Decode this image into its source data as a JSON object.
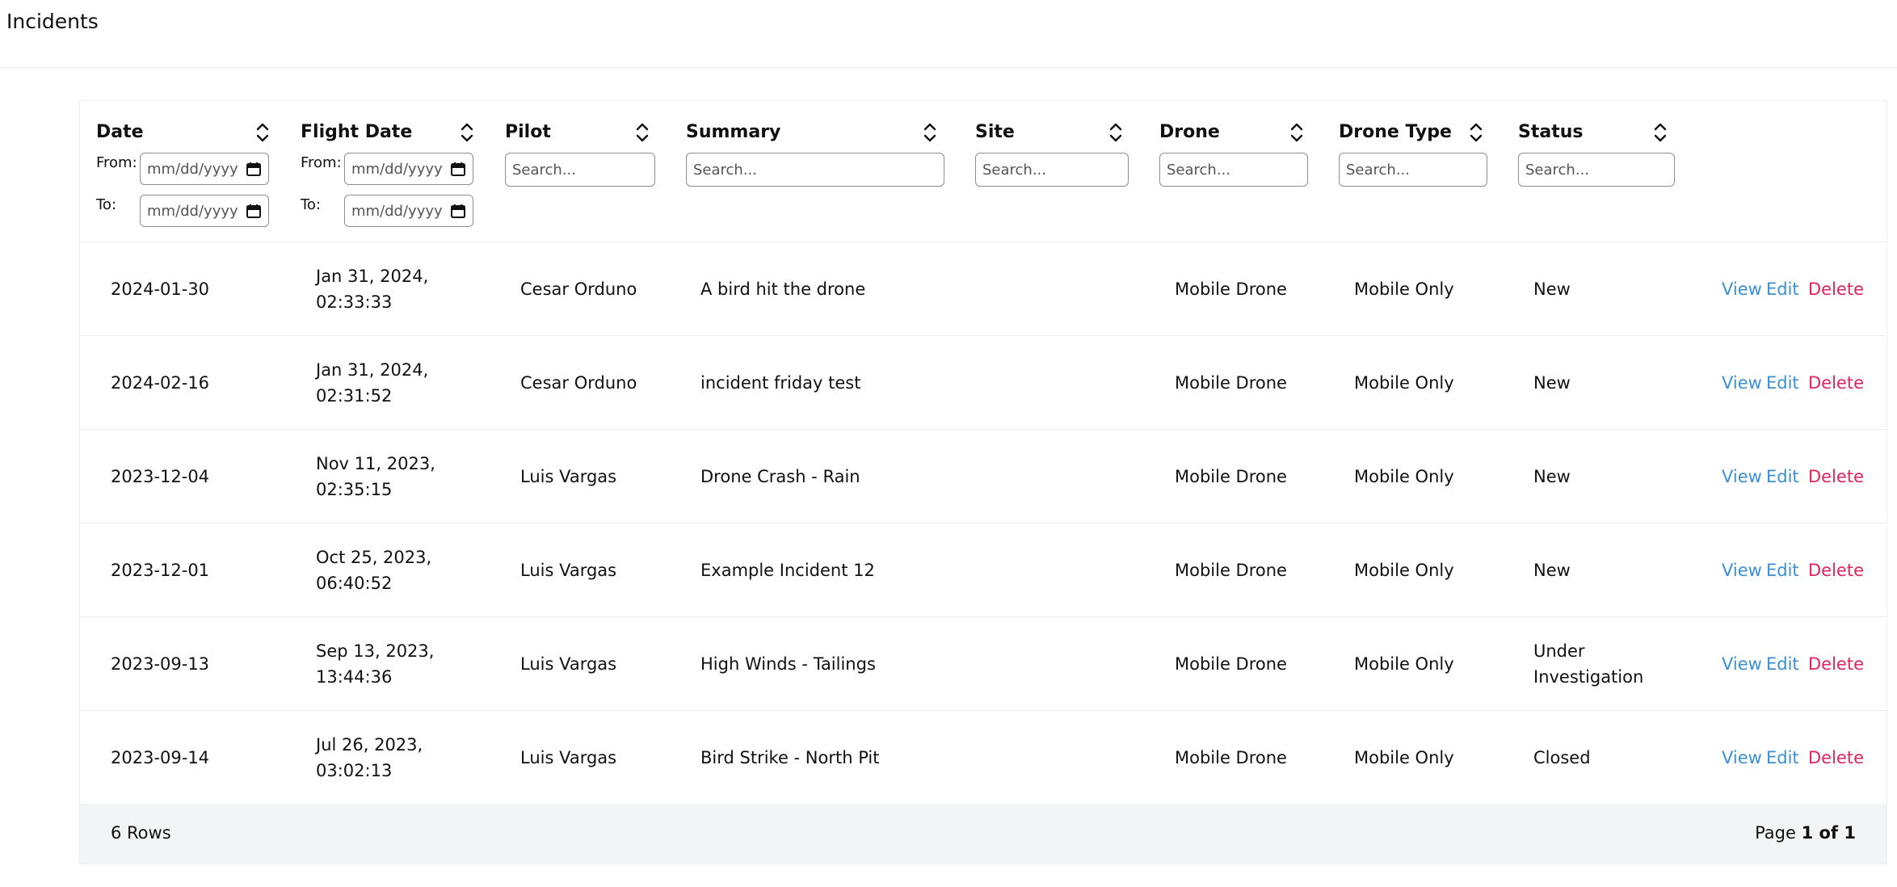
{
  "page": {
    "title": "Incidents"
  },
  "columns": [
    {
      "key": "date",
      "label": "Date",
      "filter": "date-range"
    },
    {
      "key": "flight_date",
      "label": "Flight Date",
      "filter": "date-range"
    },
    {
      "key": "pilot",
      "label": "Pilot",
      "filter": "search"
    },
    {
      "key": "summary",
      "label": "Summary",
      "filter": "search"
    },
    {
      "key": "site",
      "label": "Site",
      "filter": "search"
    },
    {
      "key": "drone",
      "label": "Drone",
      "filter": "search"
    },
    {
      "key": "drone_type",
      "label": "Drone Type",
      "filter": "search"
    },
    {
      "key": "status",
      "label": "Status",
      "filter": "search"
    }
  ],
  "filters": {
    "search_placeholder": "Search...",
    "date_placeholder": "mm/dd/yyyy",
    "from_label": "From:",
    "to_label": "To:"
  },
  "rows": [
    {
      "date": "2024-01-30",
      "flight_date": "Jan 31, 2024, 02:33:33",
      "pilot": "Cesar Orduno",
      "summary": "A bird hit the drone",
      "site": "",
      "drone": "Mobile Drone",
      "drone_type": "Mobile Only",
      "status": "New"
    },
    {
      "date": "2024-02-16",
      "flight_date": "Jan 31, 2024, 02:31:52",
      "pilot": "Cesar Orduno",
      "summary": "incident friday test",
      "site": "",
      "drone": "Mobile Drone",
      "drone_type": "Mobile Only",
      "status": "New"
    },
    {
      "date": "2023-12-04",
      "flight_date": "Nov 11, 2023, 02:35:15",
      "pilot": "Luis Vargas",
      "summary": "Drone Crash - Rain",
      "site": "",
      "drone": "Mobile Drone",
      "drone_type": "Mobile Only",
      "status": "New"
    },
    {
      "date": "2023-12-01",
      "flight_date": "Oct 25, 2023, 06:40:52",
      "pilot": "Luis Vargas",
      "summary": "Example Incident 12",
      "site": "",
      "drone": "Mobile Drone",
      "drone_type": "Mobile Only",
      "status": "New"
    },
    {
      "date": "2023-09-13",
      "flight_date": "Sep 13, 2023, 13:44:36",
      "pilot": "Luis Vargas",
      "summary": "High Winds - Tailings",
      "site": "",
      "drone": "Mobile Drone",
      "drone_type": "Mobile Only",
      "status": "Under Investigation"
    },
    {
      "date": "2023-09-14",
      "flight_date": "Jul 26, 2023, 03:02:13",
      "pilot": "Luis Vargas",
      "summary": "Bird Strike - North Pit",
      "site": "",
      "drone": "Mobile Drone",
      "drone_type": "Mobile Only",
      "status": "Closed"
    }
  ],
  "actions": {
    "view": "View",
    "edit": "Edit",
    "delete": "Delete"
  },
  "footer": {
    "rows_label": "6 Rows",
    "page_prefix": "Page",
    "page_current": "1 of 1"
  },
  "colors": {
    "link": "#3a8fd6",
    "danger": "#e0245e",
    "footer_bg": "#f3f4f6"
  },
  "icons": {
    "sort": "sort-icon",
    "calendar": "calendar-icon"
  }
}
